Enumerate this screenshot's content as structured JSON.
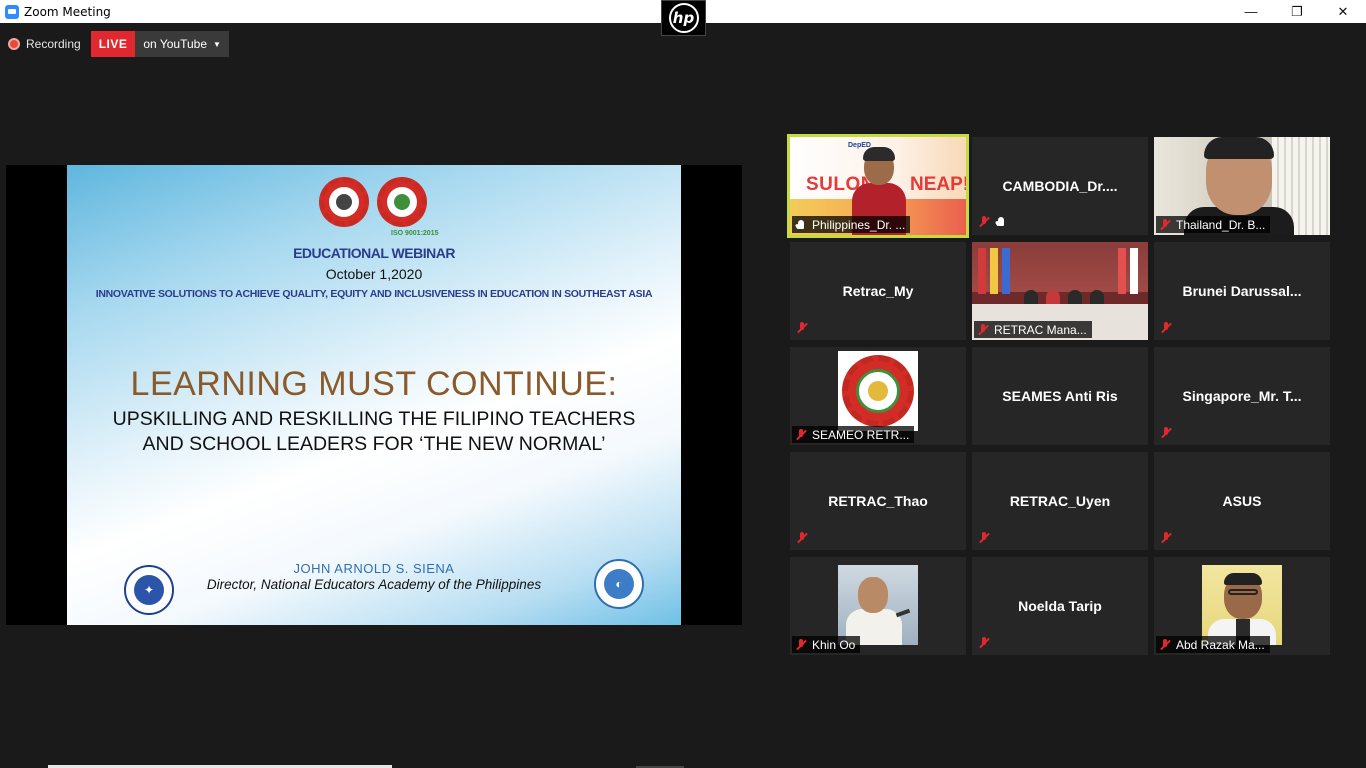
{
  "window": {
    "title": "Zoom Meeting",
    "controls": [
      "—",
      "❐",
      "✕"
    ],
    "brand_overlay": "hp"
  },
  "recording": {
    "label": "Recording",
    "live_label": "LIVE",
    "platform_label": "on YouTube",
    "colors": {
      "live": "#e0282e",
      "dot": "#e14d3a"
    }
  },
  "shared_slide": {
    "iso_text": "ISO 9001:2015",
    "event_title": "EDUCATIONAL WEBINAR",
    "event_date": "October 1,2020",
    "event_subtitle": "INNOVATIVE SOLUTIONS TO ACHIEVE QUALITY, EQUITY AND INCLUSIVENESS IN EDUCATION IN SOUTHEAST ASIA",
    "headline": "LEARNING MUST CONTINUE:",
    "subheadline_line1": "UPSKILLING AND RESKILLING THE FILIPINO TEACHERS",
    "subheadline_line2": "AND SCHOOL LEADERS FOR ‘THE NEW NORMAL’",
    "speaker_name": "JOHN ARNOLD S. SIENA",
    "speaker_role": "Director, National Educators Academy of the Philippines"
  },
  "participants": {
    "active_color": "#c4dc40",
    "tiles": [
      {
        "label": "Philippines_Dr. ...",
        "video": true,
        "active": true,
        "muted": false,
        "hand_icon": true,
        "overlay_text": "SULON",
        "overlay_text2": "NEAP!",
        "badge_text": "DepED"
      },
      {
        "name": "CAMBODIA_Dr....",
        "video": false,
        "muted": true,
        "hand_icon": true
      },
      {
        "label": "Thailand_Dr. B...",
        "video": true,
        "muted": true
      },
      {
        "name": "Retrac_My",
        "video": false,
        "muted": true
      },
      {
        "label": "RETRAC Mana...",
        "video": true,
        "muted": true
      },
      {
        "name": "Brunei  Darussal...",
        "video": false,
        "muted": true
      },
      {
        "label": "SEAMEO RETR...",
        "video": true,
        "muted": true
      },
      {
        "name": "SEAMES Anti Ris",
        "video": false,
        "muted": false
      },
      {
        "name": "Singapore_Mr.  T...",
        "video": false,
        "muted": true
      },
      {
        "name": "RETRAC_Thao",
        "video": false,
        "muted": true
      },
      {
        "name": "RETRAC_Uyen",
        "video": false,
        "muted": true
      },
      {
        "name": "ASUS",
        "video": false,
        "muted": true
      },
      {
        "label": "Khin Oo",
        "video": true,
        "muted": true
      },
      {
        "name": "Noelda Tarip",
        "video": false,
        "muted": true
      },
      {
        "label": "Abd Razak Ma...",
        "video": true,
        "muted": true
      }
    ]
  }
}
